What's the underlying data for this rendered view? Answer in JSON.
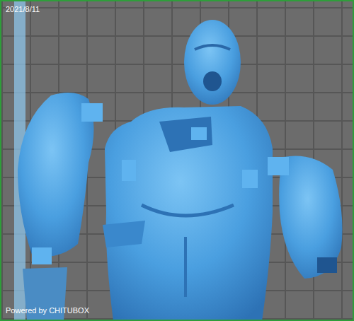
{
  "viewport": {
    "date": "2021/8/11",
    "watermark": "Powered by CHITUBOX"
  }
}
